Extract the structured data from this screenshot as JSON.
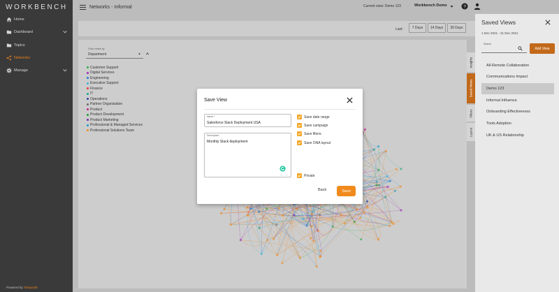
{
  "app": {
    "logo": "WORKBENCH",
    "powered_by_prefix": "Powered by",
    "powered_by_brand": "Temporall"
  },
  "sidebar": {
    "items": [
      {
        "label": "Home",
        "icon": "home-icon",
        "active": false
      },
      {
        "label": "Dashboard",
        "icon": "folder-icon",
        "active": false,
        "expandable": true
      },
      {
        "label": "Topics",
        "icon": "folder-icon",
        "active": false
      },
      {
        "label": "Networks",
        "icon": "share-icon",
        "active": true
      },
      {
        "label": "Manage",
        "icon": "gear-icon",
        "active": false,
        "expandable": true
      }
    ]
  },
  "header": {
    "title": "Networks - Informal",
    "current_view": "Current view: Demo 123",
    "workspace": "Workbench Demo"
  },
  "toolbar": {
    "last_label": "Last:",
    "ranges": [
      "7 Days",
      "14 Days",
      "30 Days"
    ]
  },
  "filters": {
    "color_by_label": "Color nodes by",
    "color_by_value": "Department"
  },
  "legend": [
    {
      "label": "Customer Support",
      "color": "#2eae4a"
    },
    {
      "label": "Digital Services",
      "color": "#9b2bb8"
    },
    {
      "label": "Engineering",
      "color": "#1f7bd1"
    },
    {
      "label": "Executive Support",
      "color": "#3cb5e0"
    },
    {
      "label": "Finance",
      "color": "#e03a3a"
    },
    {
      "label": "IT",
      "color": "#18a98f"
    },
    {
      "label": "Operations",
      "color": "#2b3fa8"
    },
    {
      "label": "Partner Organisation",
      "color": "#6a6a6a"
    },
    {
      "label": "Product",
      "color": "#c41e8a"
    },
    {
      "label": "Product Development",
      "color": "#1e9e3e"
    },
    {
      "label": "Product Marketing",
      "color": "#7b2bb0"
    },
    {
      "label": "Professional & Managed Services",
      "color": "#1aa0c8"
    },
    {
      "label": "Professional Solutions Team",
      "color": "#f08a1c"
    }
  ],
  "side_tabs": [
    "Insights",
    "Saved Views",
    "Filters",
    "Layout"
  ],
  "saved_views": {
    "title": "Saved Views",
    "date_range": "1 Dec 2021 - 31 Dec 2021",
    "search_label": "Search",
    "add_label": "Add View",
    "items": [
      {
        "label": "All-Remote Collaboration",
        "active": false
      },
      {
        "label": "Communications Impact",
        "active": false
      },
      {
        "label": "Demo 123",
        "active": true
      },
      {
        "label": "Informal Influence",
        "active": false
      },
      {
        "label": "Onboarding Effectiveness",
        "active": false
      },
      {
        "label": "Tools Adoption",
        "active": false
      },
      {
        "label": "UK & US Relationship",
        "active": false
      }
    ]
  },
  "modal": {
    "title": "Save View",
    "name_label": "Name *",
    "name_value": "Salesforce Slack Deployment USA",
    "description_label": "Description",
    "description_value": "Monthly Slack deployment",
    "checkboxes": [
      "Save date range",
      "Save campaign",
      "Save filters",
      "Save ONA layout"
    ],
    "private_label": "Private",
    "back_label": "Back",
    "save_label": "Save"
  },
  "colors": {
    "accent": "#f08a1c",
    "accent_dark": "#c2691a",
    "sidebar_bg": "#3a3a3a"
  }
}
